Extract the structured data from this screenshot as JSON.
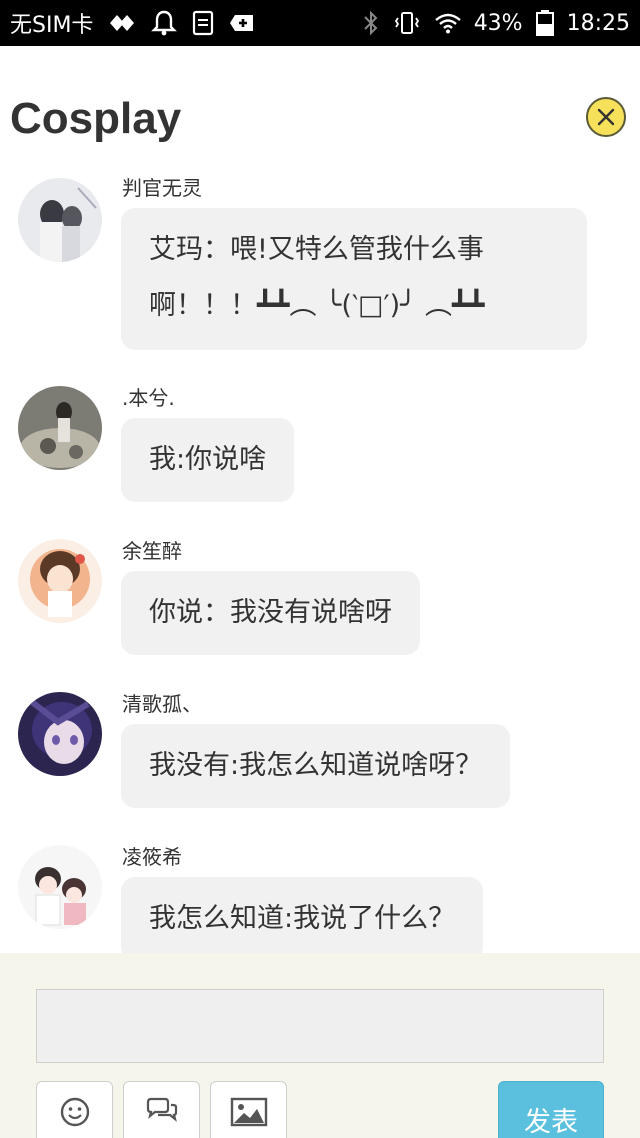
{
  "status_bar": {
    "carrier": "无SIM卡",
    "battery": "43%",
    "time": "18:25"
  },
  "header": {
    "title": "Cosplay",
    "close_icon": "close-icon"
  },
  "messages": [
    {
      "nickname": "判官无灵",
      "text": "艾玛：喂!又特么管我什么事啊！！！┻┻︵ ╰(‵□′)╯ ︵┻┻",
      "avatar": "avatar-1"
    },
    {
      "nickname": ".本兮.",
      "text": "我:你说啥",
      "avatar": "avatar-2"
    },
    {
      "nickname": "余笙醉",
      "text": "你说：我没有说啥呀",
      "avatar": "avatar-3"
    },
    {
      "nickname": "清歌孤、",
      "text": "我没有:我怎么知道说啥呀？",
      "avatar": "avatar-4"
    },
    {
      "nickname": "凌筱希",
      "text": "我怎么知道:我说了什么？",
      "avatar": "avatar-5"
    }
  ],
  "compose": {
    "input_value": "",
    "input_placeholder": "",
    "emoji_icon": "smiley-icon",
    "comment_icon": "chat-bubbles-icon",
    "image_icon": "image-icon",
    "send_label": "发表"
  },
  "colors": {
    "bubble_bg": "#f1f1f1",
    "send_button": "#5bc0de",
    "close_button": "#f7e15a",
    "compose_bg": "#f5f5ec"
  }
}
